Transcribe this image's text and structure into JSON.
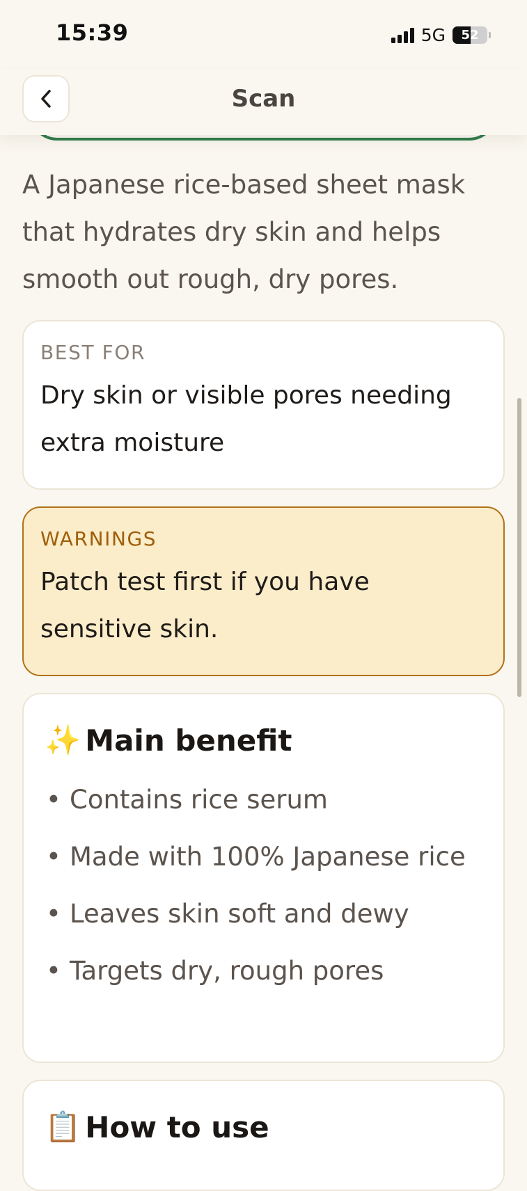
{
  "status_bar": {
    "time": "15:39",
    "network": "5G",
    "battery": "52",
    "battery_level": 0.52
  },
  "header": {
    "title": "Scan",
    "back_icon": "chevron-left-icon"
  },
  "description": "A Japanese rice-based sheet mask that hydrates dry skin and helps smooth out rough, dry pores.",
  "best_for": {
    "label": "BEST FOR",
    "text": "Dry skin or visible pores needing extra moisture"
  },
  "warnings": {
    "label": "WARNINGS",
    "text": "Patch test first if you have sensitive skin."
  },
  "main_benefit": {
    "emoji": "✨",
    "title": "Main benefit",
    "bullet": "•",
    "items": [
      "Contains rice serum",
      "Made with 100% Japanese rice",
      "Leaves skin soft and dewy",
      "Targets dry, rough pores"
    ]
  },
  "how_to_use": {
    "emoji": "📋",
    "title": "How to use"
  },
  "colors": {
    "background": "#faf7f0",
    "green_accent": "#2f7c4b",
    "warning_bg": "#fbedca",
    "warning_border": "#b07218",
    "warning_label": "#a05e0a"
  }
}
